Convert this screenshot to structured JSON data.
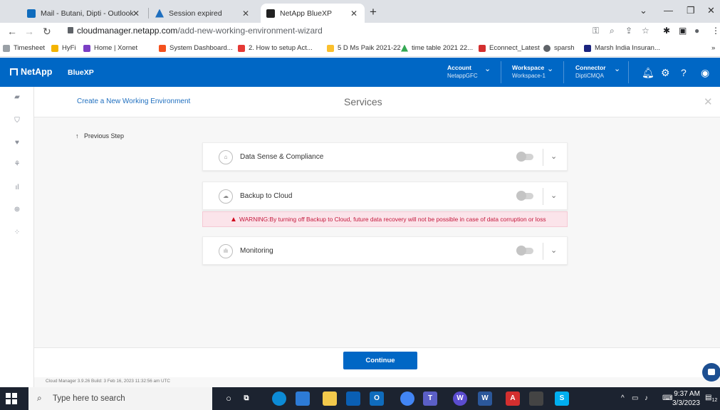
{
  "browser": {
    "tabs": [
      {
        "label": "Mail - Butani, Dipti - Outlook",
        "fav_color": "#0f6cbd"
      },
      {
        "label": "Session expired",
        "fav_color": "#1f6fbf"
      },
      {
        "label": "NetApp BlueXP",
        "fav_color": "#222222"
      }
    ],
    "new_tab": "+",
    "url_host": "cloudmanager.netapp.com",
    "url_path": "/add-new-working-environment-wizard",
    "bookmarks": [
      {
        "label": "Timesheet",
        "color": "#9aa0a6"
      },
      {
        "label": "HyFi",
        "color": "#f4b400"
      },
      {
        "label": "Home | Xornet",
        "color": "#7b3fc4"
      },
      {
        "label": "System Dashboard...",
        "color": "#f4511e"
      },
      {
        "label": "2. How to setup Act...",
        "color": "#e53935"
      },
      {
        "label": "5 D Ms Paik 2021-22",
        "color": "#fbc02d"
      },
      {
        "label": "time table 2021 22...",
        "color": "#34a853"
      },
      {
        "label": "Econnect_Latest",
        "color": "#d32f2f"
      },
      {
        "label": "sparsh",
        "color": "#5f6368"
      },
      {
        "label": "Marsh India Insuran...",
        "color": "#1a237e"
      }
    ],
    "bookmarks_more": "»"
  },
  "app": {
    "brand": "NetApp",
    "product": "BlueXP",
    "account_title": "Account",
    "account_value": "NetappGFC",
    "workspace_title": "Workspace",
    "workspace_value": "Workspace-1",
    "connector_title": "Connector",
    "connector_value": "DiptiCMQA"
  },
  "wizard": {
    "breadcrumb": "Create a New Working Environment",
    "title": "Services",
    "previous_step": "Previous Step",
    "services": [
      {
        "name": "Data Sense & Compliance",
        "icon": "data-sense-icon",
        "enabled": false
      },
      {
        "name": "Backup to Cloud",
        "icon": "cloud-backup-icon",
        "enabled": false
      },
      {
        "name": "Monitoring",
        "icon": "monitoring-icon",
        "enabled": false
      }
    ],
    "warning": "WARNING:By turning off Backup to Cloud, future data recovery will not be possible in case of data corruption or loss",
    "continue_label": "Continue",
    "version": "Cloud Manager 3.9.26   Build: 3   Feb 16, 2023 11:32:56 am UTC"
  },
  "taskbar": {
    "search_placeholder": "Type here to search",
    "time": "9:37 AM",
    "date": "3/3/2023",
    "notification_count": "12"
  },
  "colors": {
    "brand_blue": "#0067c5",
    "warning_bg": "#fbe4ea",
    "warning_text": "#c4183c"
  }
}
